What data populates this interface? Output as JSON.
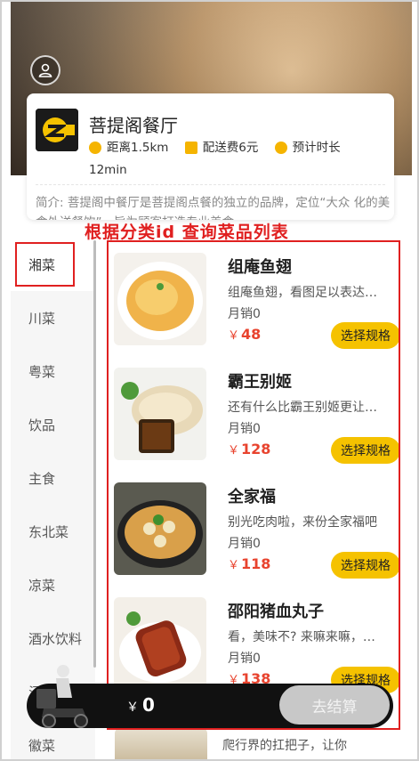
{
  "shop": {
    "name": "菩提阁餐厅",
    "distance": "距离1.5km",
    "delivery_fee": "配送费6元",
    "eta_line1": "预计时长",
    "eta_line2": "12min",
    "intro": "简介: 菩提阁中餐厅是菩提阁点餐的独立的品牌，定位“大众 化的美食外送餐饮”，旨为顾客打造专业美食。"
  },
  "annotation": {
    "title": "根据分类id 查询菜品列表"
  },
  "categories": [
    "湘菜",
    "川菜",
    "粤菜",
    "饮品",
    "主食",
    "东北菜",
    "凉菜",
    "酒水饮料",
    "汤类",
    "徽菜"
  ],
  "active_category": "湘菜",
  "dishes": [
    {
      "name": "组庵鱼翅",
      "desc": "组庵鱼翅，看图足以表达一切",
      "sales": "月销0",
      "price": "48",
      "currency": "￥",
      "button": "选择规格"
    },
    {
      "name": "霸王别姬",
      "desc": "还有什么比霸王别姬更让人心潮澎湃",
      "sales": "月销0",
      "price": "128",
      "currency": "￥",
      "button": "选择规格"
    },
    {
      "name": "全家福",
      "desc": "别光吃肉啦，来份全家福吧",
      "sales": "月销0",
      "price": "118",
      "currency": "￥",
      "button": "选择规格"
    },
    {
      "name": "邵阳猪血丸子",
      "desc": "看，美味不? 来嘛来嘛，这才是最爱吖!",
      "sales": "月销0",
      "price": "138",
      "currency": "￥",
      "button": "选择规格"
    }
  ],
  "next_dish_peek": "爬行界的扛把子，让你",
  "cart": {
    "currency": "￥",
    "total": "0",
    "checkout_label": "去结算"
  },
  "colors": {
    "accent": "#f5c200",
    "price": "#e8432e",
    "annotation": "#e02020"
  }
}
